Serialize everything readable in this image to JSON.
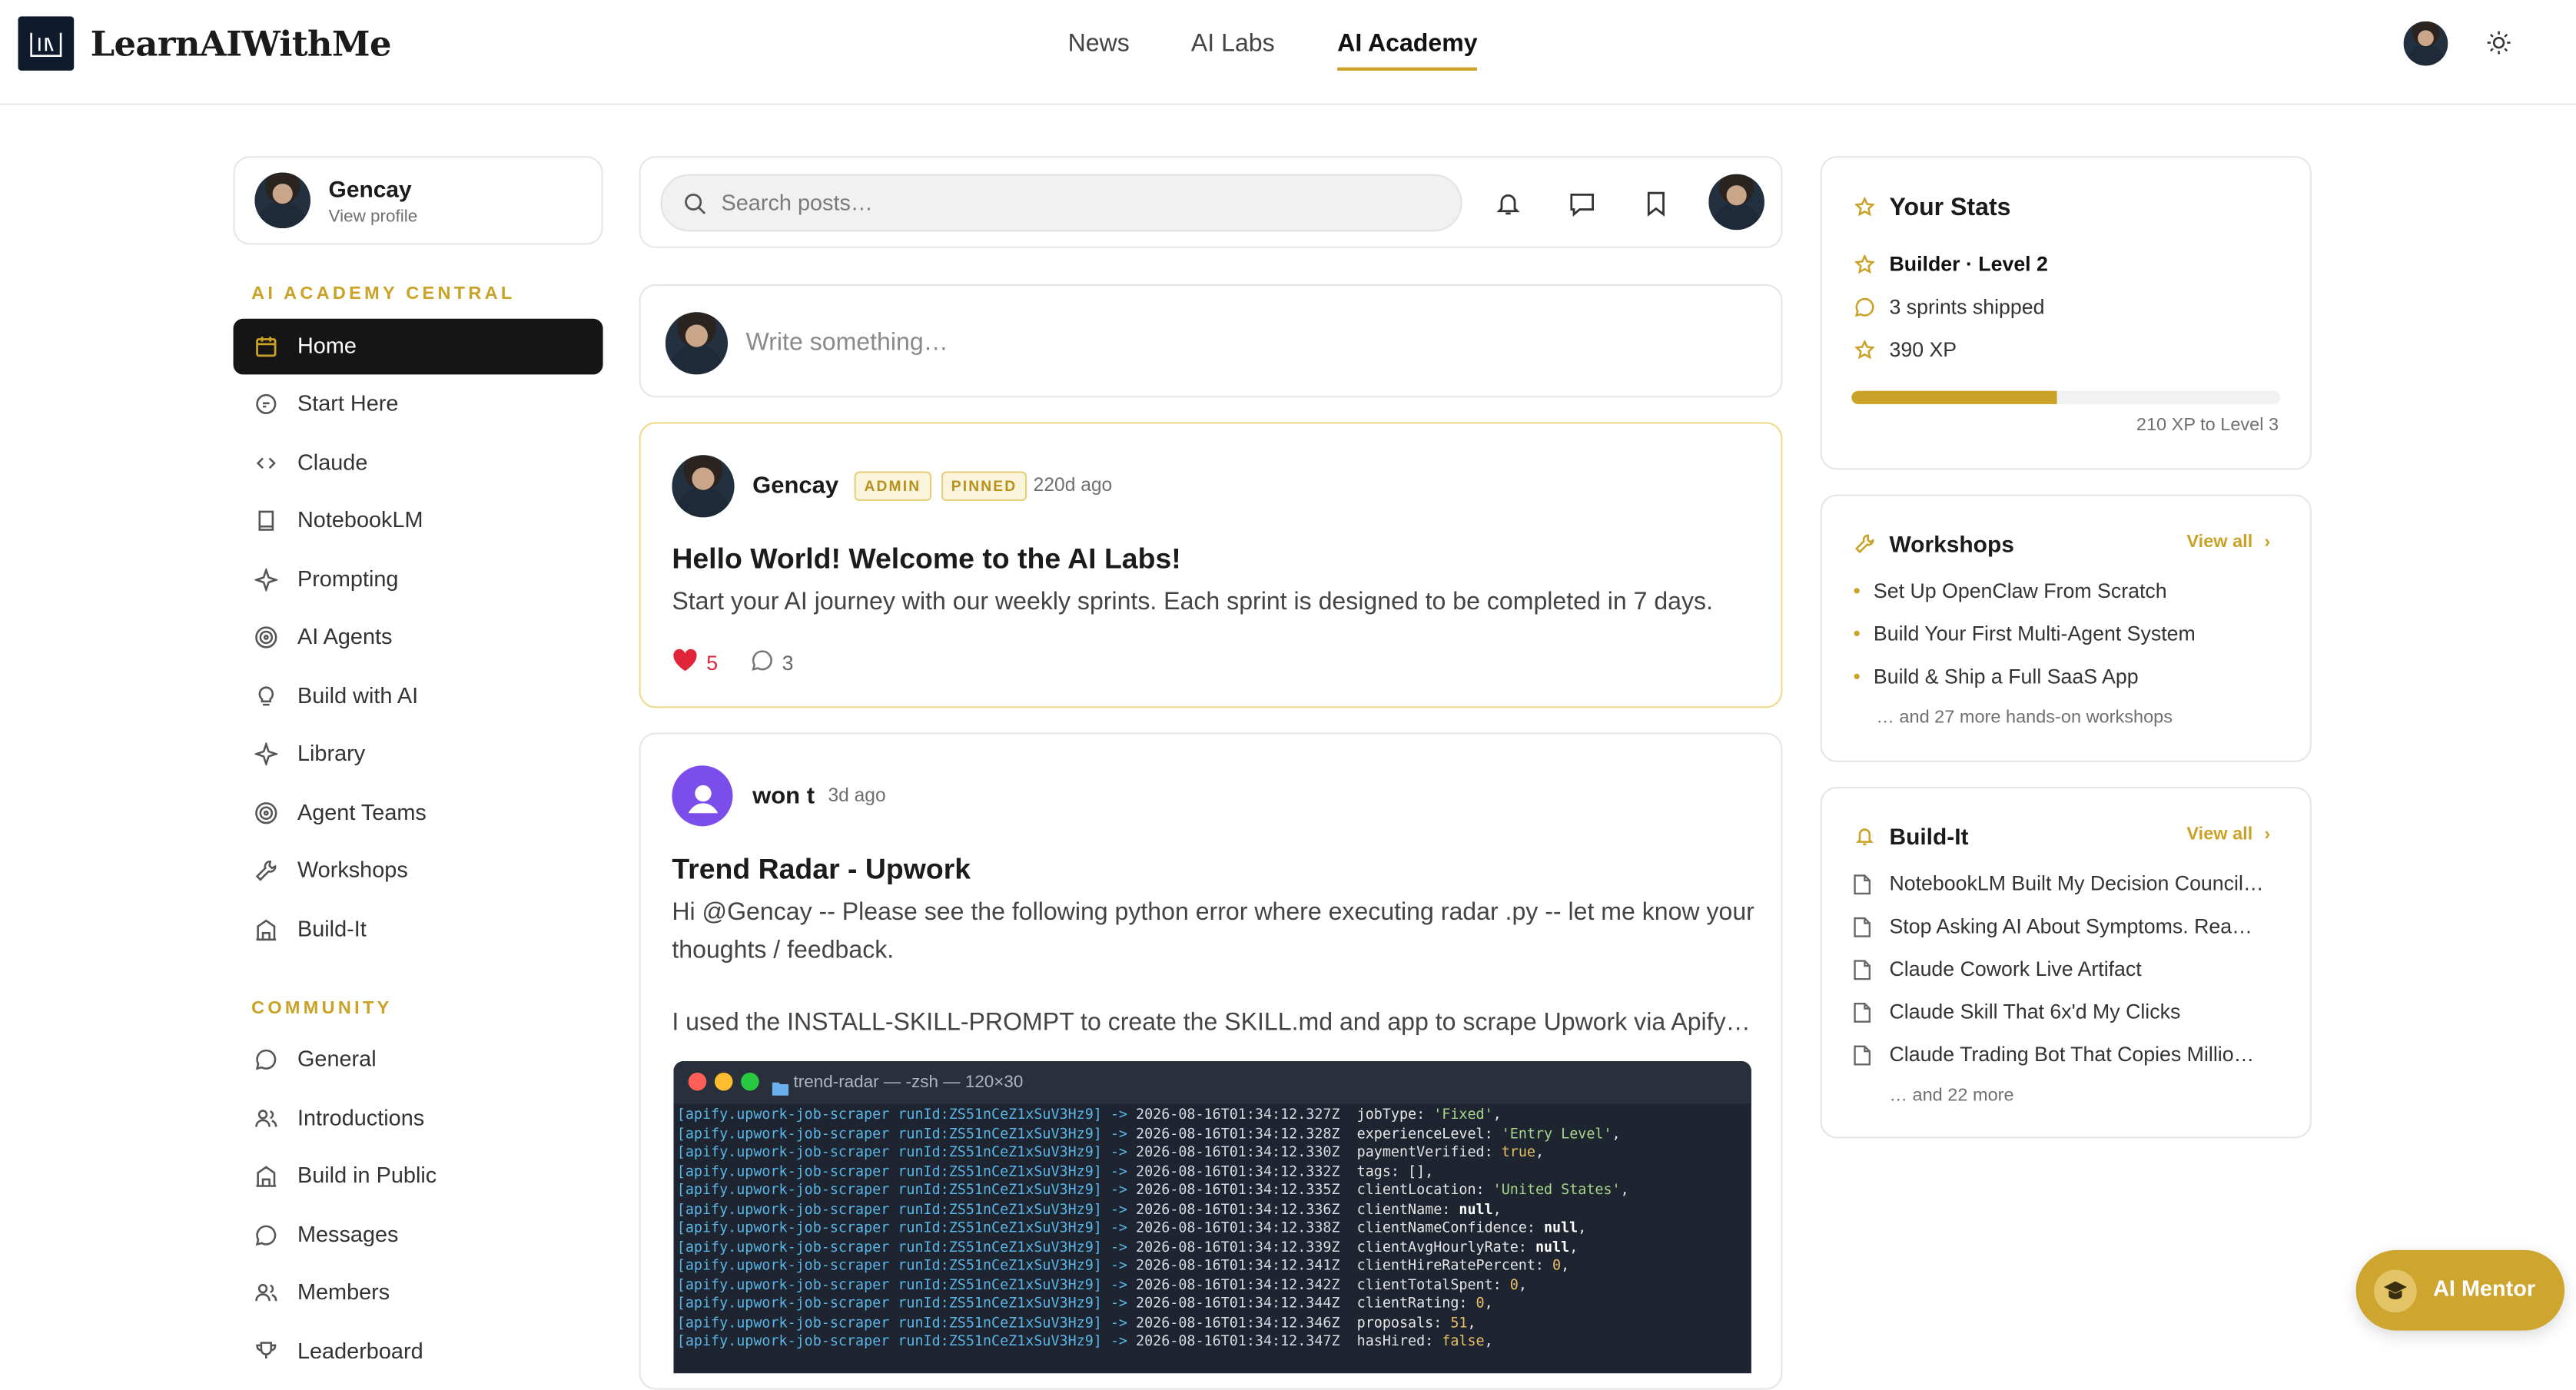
{
  "header": {
    "brand": "LearnAIWithMe",
    "nav": [
      "News",
      "AI Labs",
      "AI Academy"
    ],
    "active_nav": "AI Academy"
  },
  "sidebar": {
    "profile": {
      "name": "Gencay",
      "sub": "View profile"
    },
    "sections": [
      {
        "title": "AI ACADEMY CENTRAL",
        "items": [
          {
            "label": "Home",
            "icon": "calendar-icon",
            "active": true
          },
          {
            "label": "Start Here",
            "icon": "chat-bubble-icon"
          },
          {
            "label": "Claude",
            "icon": "code-icon"
          },
          {
            "label": "NotebookLM",
            "icon": "book-icon"
          },
          {
            "label": "Prompting",
            "icon": "sparkle-icon"
          },
          {
            "label": "AI Agents",
            "icon": "target-icon"
          },
          {
            "label": "Build with AI",
            "icon": "lightbulb-icon"
          },
          {
            "label": "Library",
            "icon": "sparkle-icon"
          },
          {
            "label": "Agent Teams",
            "icon": "target-icon"
          },
          {
            "label": "Workshops",
            "icon": "wrench-icon"
          },
          {
            "label": "Build-It",
            "icon": "building-icon"
          }
        ]
      },
      {
        "title": "COMMUNITY",
        "items": [
          {
            "label": "General",
            "icon": "chat-bubble-icon"
          },
          {
            "label": "Introductions",
            "icon": "users-icon"
          },
          {
            "label": "Build in Public",
            "icon": "building-icon"
          },
          {
            "label": "Messages",
            "icon": "chat-bubble-icon"
          },
          {
            "label": "Members",
            "icon": "users-icon"
          },
          {
            "label": "Leaderboard",
            "icon": "trophy-icon"
          }
        ]
      }
    ]
  },
  "feed": {
    "search_placeholder": "Search posts…",
    "compose_placeholder": "Write something…",
    "posts": [
      {
        "author": "Gencay",
        "badges": [
          "ADMIN",
          "PINNED"
        ],
        "time": "220d ago",
        "title": "Hello World! Welcome to the AI Labs!",
        "body": "Start your AI journey with our weekly sprints. Each sprint is designed to be completed in 7 days.",
        "likes": "5",
        "comments": "3"
      },
      {
        "author": "won t",
        "time": "3d ago",
        "title": "Trend Radar - Upwork",
        "body_1": "Hi @Gencay -- Please see the following python error where executing radar .py -- let me know your thoughts / feedback.",
        "body_2": "I used the INSTALL-SKILL-PROMPT to create the SKILL.md and app to scrape Upwork via Apify…",
        "terminal": {
          "title": "trend-radar — -zsh — 120×30",
          "prefix": "[apify.upwork-job-scraper runId:ZS51nCeZ1xSuV3Hz9] ->",
          "rows": [
            {
              "time": "2026-08-16T01:34:12.327Z",
              "key": "jobType: ",
              "val": "'Fixed'",
              "kind": "str"
            },
            {
              "time": "2026-08-16T01:34:12.328Z",
              "key": "experienceLevel: ",
              "val": "'Entry Level'",
              "kind": "str"
            },
            {
              "time": "2026-08-16T01:34:12.330Z",
              "key": "paymentVerified: ",
              "val": "true",
              "kind": "num"
            },
            {
              "time": "2026-08-16T01:34:12.332Z",
              "key": "tags: ",
              "val": "[],",
              "kind": "plain"
            },
            {
              "time": "2026-08-16T01:34:12.335Z",
              "key": "clientLocation: ",
              "val": "'United States'",
              "kind": "str"
            },
            {
              "time": "2026-08-16T01:34:12.336Z",
              "key": "clientName: ",
              "val": "null",
              "kind": "bold"
            },
            {
              "time": "2026-08-16T01:34:12.338Z",
              "key": "clientNameConfidence: ",
              "val": "null",
              "kind": "bold"
            },
            {
              "time": "2026-08-16T01:34:12.339Z",
              "key": "clientAvgHourlyRate: ",
              "val": "null",
              "kind": "bold"
            },
            {
              "time": "2026-08-16T01:34:12.341Z",
              "key": "clientHireRatePercent: ",
              "val": "0",
              "kind": "num"
            },
            {
              "time": "2026-08-16T01:34:12.342Z",
              "key": "clientTotalSpent: ",
              "val": "0",
              "kind": "num"
            },
            {
              "time": "2026-08-16T01:34:12.344Z",
              "key": "clientRating: ",
              "val": "0",
              "kind": "num"
            },
            {
              "time": "2026-08-16T01:34:12.346Z",
              "key": "proposals: ",
              "val": "51",
              "kind": "num"
            },
            {
              "time": "2026-08-16T01:34:12.347Z",
              "key": "hasHired: ",
              "val": "false",
              "kind": "num"
            }
          ]
        }
      }
    ]
  },
  "stats": {
    "title": "Your Stats",
    "level": "Builder · Level 2",
    "sprints": "3 sprints shipped",
    "xp": "390 XP",
    "progress_fraction": 0.48,
    "progress_note": "210 XP to Level 3"
  },
  "workshops": {
    "title": "Workshops",
    "view_all": "View all",
    "items": [
      "Set Up OpenClaw From Scratch",
      "Build Your First Multi-Agent System",
      "Build & Ship a Full SaaS App"
    ],
    "more": "… and 27 more hands-on workshops"
  },
  "buildit": {
    "title": "Build-It",
    "view_all": "View all",
    "items": [
      "NotebookLM Built My Decision Council…",
      "Stop Asking AI About Symptoms. Rea…",
      "Claude Cowork Live Artifact",
      "Claude Skill That 6x'd My Clicks",
      "Claude Trading Bot That Copies Millio…"
    ],
    "more": "… and 22 more"
  },
  "mentor": {
    "label": "AI Mentor"
  },
  "colors": {
    "accent": "#C9A227",
    "active_nav_bg": "#151515",
    "like": "#E0243A"
  }
}
